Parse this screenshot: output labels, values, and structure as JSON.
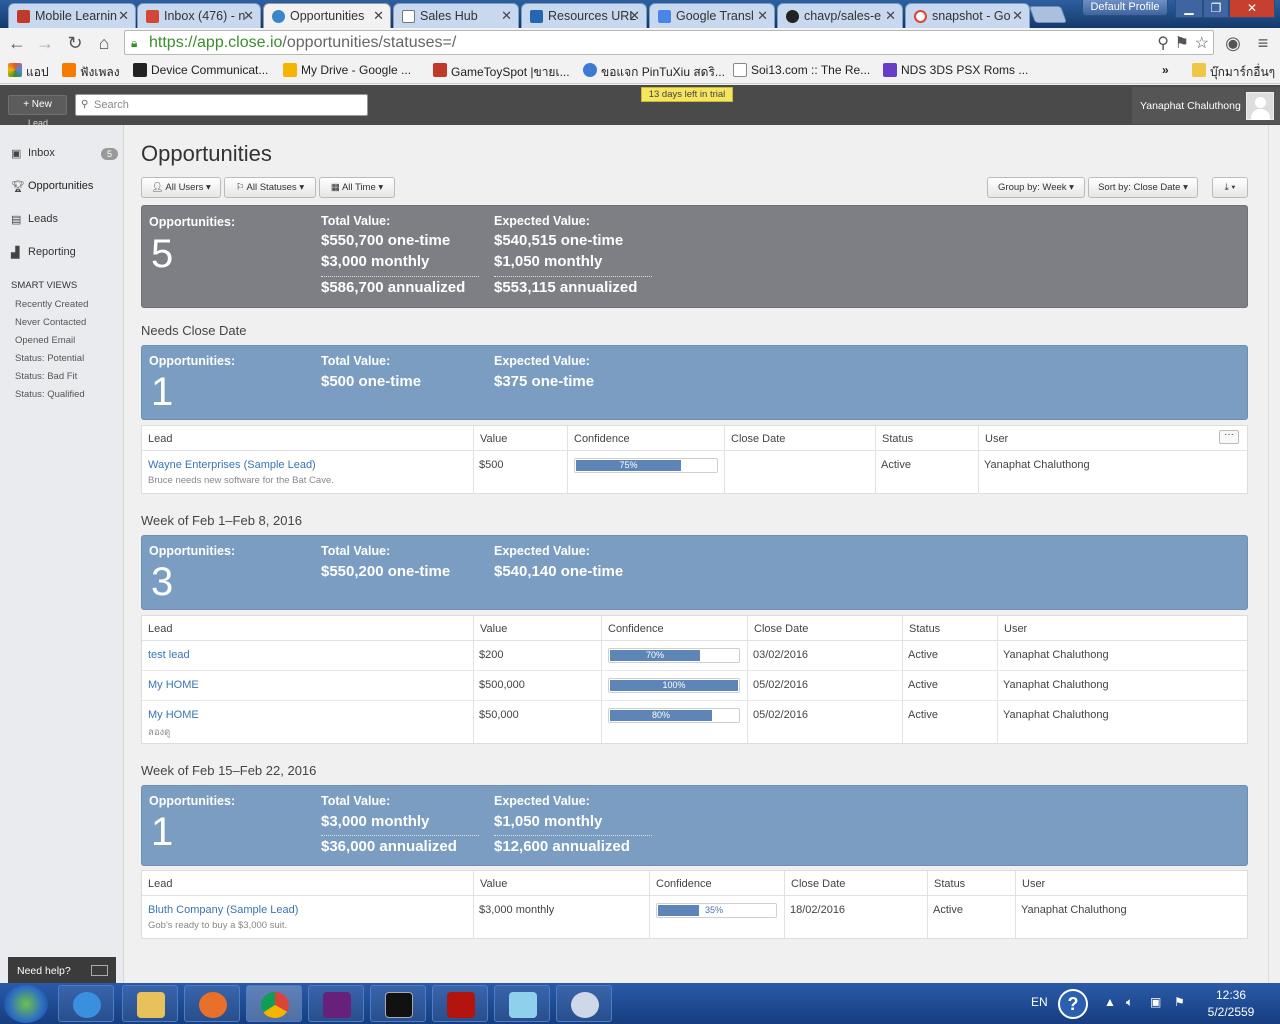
{
  "browser": {
    "tabs": [
      {
        "label": "Mobile Learnin",
        "color": "#c0392b"
      },
      {
        "label": "Inbox (476) - n",
        "color": "#d44638"
      },
      {
        "label": "Opportunities",
        "color": "#3a86c8"
      },
      {
        "label": "Sales Hub",
        "color": "#777"
      },
      {
        "label": "Resources URL",
        "color": "#2566b0"
      },
      {
        "label": "Google Transl",
        "color": "#4a86e8"
      },
      {
        "label": "chavp/sales-e",
        "color": "#222"
      },
      {
        "label": "snapshot - Go",
        "color": "#db4437"
      }
    ],
    "profile_label": "Default Profile",
    "url_host": "https://app.close.io",
    "url_path": "/opportunities/statuses=/",
    "bookmarks": [
      {
        "label": "แอป",
        "color": "#e05a2b"
      },
      {
        "label": "ฟังเพลง",
        "color": "#f57c00"
      },
      {
        "label": "Device Communicat...",
        "color": "#222"
      },
      {
        "label": "My Drive - Google ...",
        "color": "#f4b400"
      },
      {
        "label": "GameToySpot |ขายเ...",
        "color": "#c0392b"
      },
      {
        "label": "ขอแจก PinTuXiu สดริ...",
        "color": "#3c7bd1"
      },
      {
        "label": "Soi13.com :: The Re...",
        "color": "#888"
      },
      {
        "label": "NDS 3DS PSX Roms ...",
        "color": "#6a3dc8"
      }
    ],
    "bookmarks_overflow": "»",
    "other_bookmarks": "บุ๊กมาร์กอื่นๆ"
  },
  "app": {
    "new_button": "+ New",
    "new_sub": "Lead",
    "search_placeholder": "Search",
    "trial_text": "13 days left in trial",
    "user_name": "Yanaphat Chaluthong"
  },
  "sidebar": {
    "inbox": "Inbox",
    "inbox_count": "5",
    "opportunities": "Opportunities",
    "leads": "Leads",
    "reporting": "Reporting",
    "smart_views_title": "SMART VIEWS",
    "smart_views": [
      "Recently Created",
      "Never Contacted",
      "Opened Email",
      "Status: Potential",
      "Status: Bad Fit",
      "Status: Qualified"
    ],
    "need_help": "Need help?"
  },
  "page": {
    "title": "Opportunities",
    "filters": {
      "users": "All Users",
      "statuses": "All Statuses",
      "time": "All Time"
    },
    "group_by": "Group by: Week",
    "sort_by": "Sort by: Close Date"
  },
  "labels": {
    "opportunities": "Opportunities:",
    "total_value": "Total Value:",
    "expected_value": "Expected Value:"
  },
  "summary": {
    "count": "5",
    "total": [
      "$550,700 one-time",
      "$3,000 monthly",
      "$586,700 annualized"
    ],
    "expected": [
      "$540,515 one-time",
      "$1,050 monthly",
      "$553,115 annualized"
    ]
  },
  "columns": [
    "Lead",
    "Value",
    "Confidence",
    "Close Date",
    "Status",
    "User"
  ],
  "groups": [
    {
      "title": "Needs Close Date",
      "count": "1",
      "total": [
        "$500 one-time"
      ],
      "expected": [
        "$375 one-time"
      ],
      "rows": [
        {
          "lead": "Wayne Enterprises (Sample Lead)",
          "note": "Bruce needs new software for the Bat Cave.",
          "value": "$500",
          "confidence": 75,
          "confidence_label": "75%",
          "close_date": "",
          "status": "Active",
          "user": "Yanaphat Chaluthong"
        }
      ]
    },
    {
      "title": "Week of Feb 1–Feb 8, 2016",
      "count": "3",
      "total": [
        "$550,200 one-time"
      ],
      "expected": [
        "$540,140 one-time"
      ],
      "rows": [
        {
          "lead": "test lead",
          "note": "",
          "value": "$200",
          "confidence": 70,
          "confidence_label": "70%",
          "close_date": "03/02/2016",
          "status": "Active",
          "user": "Yanaphat Chaluthong"
        },
        {
          "lead": "My HOME",
          "note": "",
          "value": "$500,000",
          "confidence": 100,
          "confidence_label": "100%",
          "close_date": "05/02/2016",
          "status": "Active",
          "user": "Yanaphat Chaluthong"
        },
        {
          "lead": "My HOME",
          "note": "ลองดู",
          "value": "$50,000",
          "confidence": 80,
          "confidence_label": "80%",
          "close_date": "05/02/2016",
          "status": "Active",
          "user": "Yanaphat Chaluthong"
        }
      ]
    },
    {
      "title": "Week of Feb 15–Feb 22, 2016",
      "count": "1",
      "total": [
        "$3,000 monthly",
        "$36,000 annualized"
      ],
      "expected": [
        "$1,050 monthly",
        "$12,600 annualized"
      ],
      "rows": [
        {
          "lead": "Bluth Company (Sample Lead)",
          "note": "Gob's ready to buy a $3,000 suit.",
          "value": "$3,000 monthly",
          "confidence": 35,
          "confidence_label": "35%",
          "close_date": "18/02/2016",
          "status": "Active",
          "user": "Yanaphat Chaluthong"
        }
      ]
    }
  ],
  "taskbar": {
    "language": "EN",
    "time": "12:36",
    "date": "5/2/2559"
  }
}
